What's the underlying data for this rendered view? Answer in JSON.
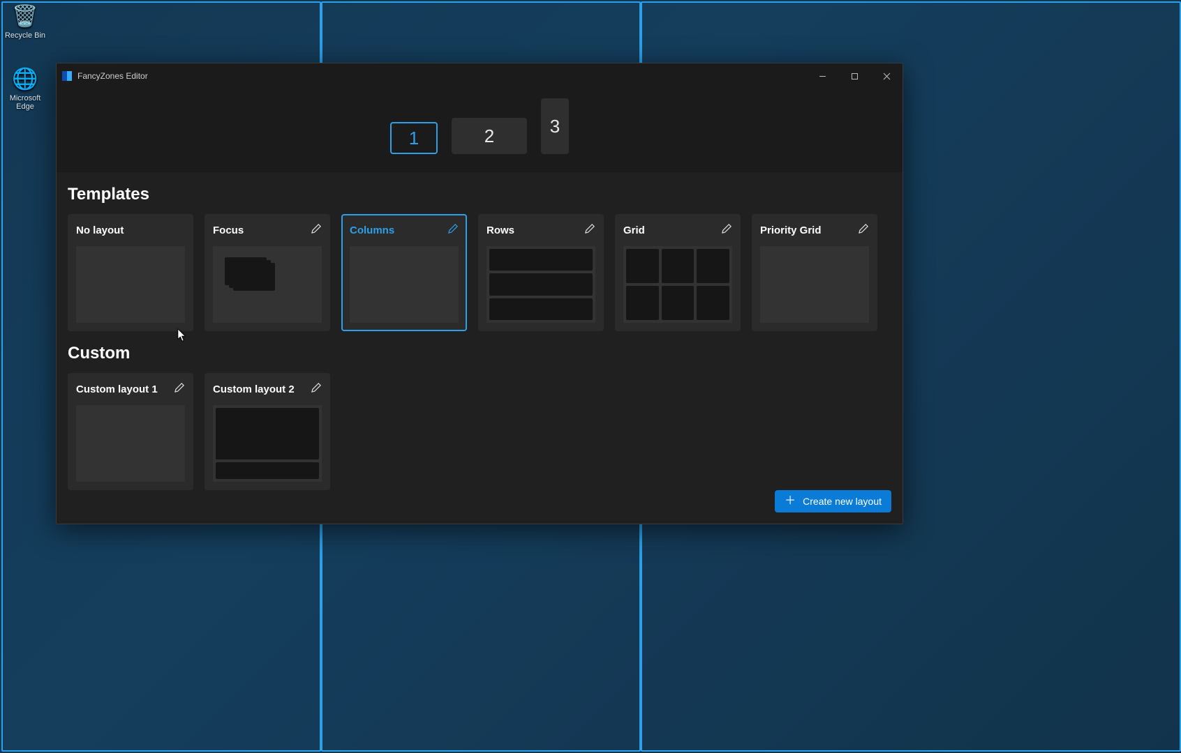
{
  "desktop": {
    "icons": [
      {
        "label": "Recycle Bin"
      },
      {
        "label": "Microsoft Edge"
      }
    ]
  },
  "window": {
    "title": "FancyZones Editor",
    "monitors": [
      {
        "label": "1",
        "selected": true
      },
      {
        "label": "2",
        "selected": false
      },
      {
        "label": "3",
        "selected": false
      }
    ],
    "sections": {
      "templates_title": "Templates",
      "custom_title": "Custom"
    },
    "templates": [
      {
        "name": "No layout",
        "editable": false,
        "selected": false
      },
      {
        "name": "Focus",
        "editable": true,
        "selected": false
      },
      {
        "name": "Columns",
        "editable": true,
        "selected": true
      },
      {
        "name": "Rows",
        "editable": true,
        "selected": false
      },
      {
        "name": "Grid",
        "editable": true,
        "selected": false
      },
      {
        "name": "Priority Grid",
        "editable": true,
        "selected": false
      }
    ],
    "custom": [
      {
        "name": "Custom layout 1"
      },
      {
        "name": "Custom layout 2"
      }
    ],
    "create_button": "Create new layout"
  },
  "colors": {
    "accent": "#2da0e7",
    "button_primary": "#0a7bd6"
  }
}
